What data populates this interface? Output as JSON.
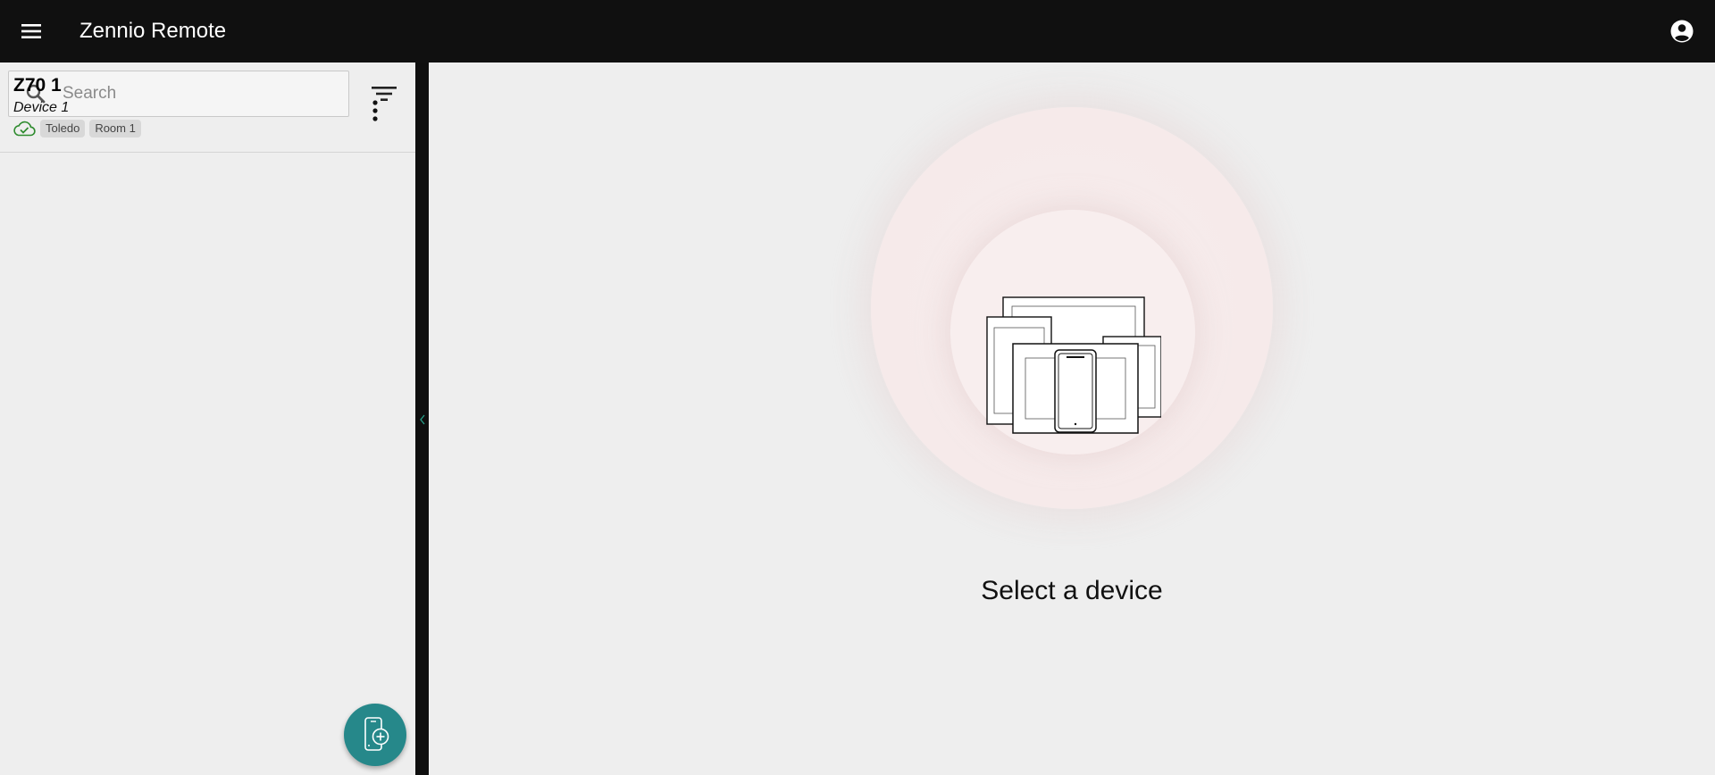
{
  "header": {
    "title": "Zennio Remote",
    "menu_icon": "hamburger-menu-icon",
    "account_icon": "account-circle-icon"
  },
  "sidebar": {
    "search": {
      "placeholder": "Search",
      "value": ""
    },
    "filter_icon": "filter-icon",
    "devices": [
      {
        "name": "Z70 1",
        "description": "Device 1",
        "status_icon": "cloud-check-icon",
        "status_color": "#2e8b2e",
        "tags": [
          "Toledo",
          "Room 1"
        ]
      }
    ],
    "fab_icon": "add-device-icon",
    "fab_color": "#26888a"
  },
  "main": {
    "empty_message": "Select a device"
  },
  "colors": {
    "topbar": "#101010",
    "background": "#eeeeee",
    "accent": "#26888a"
  }
}
